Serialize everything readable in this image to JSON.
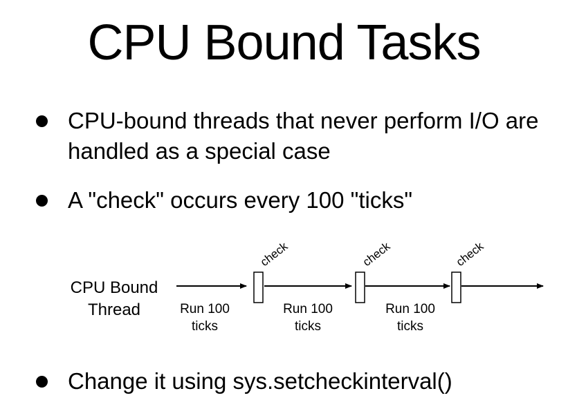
{
  "slide": {
    "title": "CPU Bound Tasks",
    "bullets": [
      "CPU-bound threads that never perform I/O are handled as a special case",
      "A \"check\" occurs every 100 \"ticks\"",
      "Change it using sys.setcheckinterval()"
    ]
  },
  "diagram": {
    "thread_label_line1": "CPU Bound",
    "thread_label_line2": "Thread",
    "segments": [
      {
        "line1": "Run 100",
        "line2": "ticks"
      },
      {
        "line1": "Run 100",
        "line2": "ticks"
      },
      {
        "line1": "Run 100",
        "line2": "ticks"
      }
    ],
    "checks": [
      "check",
      "check",
      "check"
    ]
  }
}
